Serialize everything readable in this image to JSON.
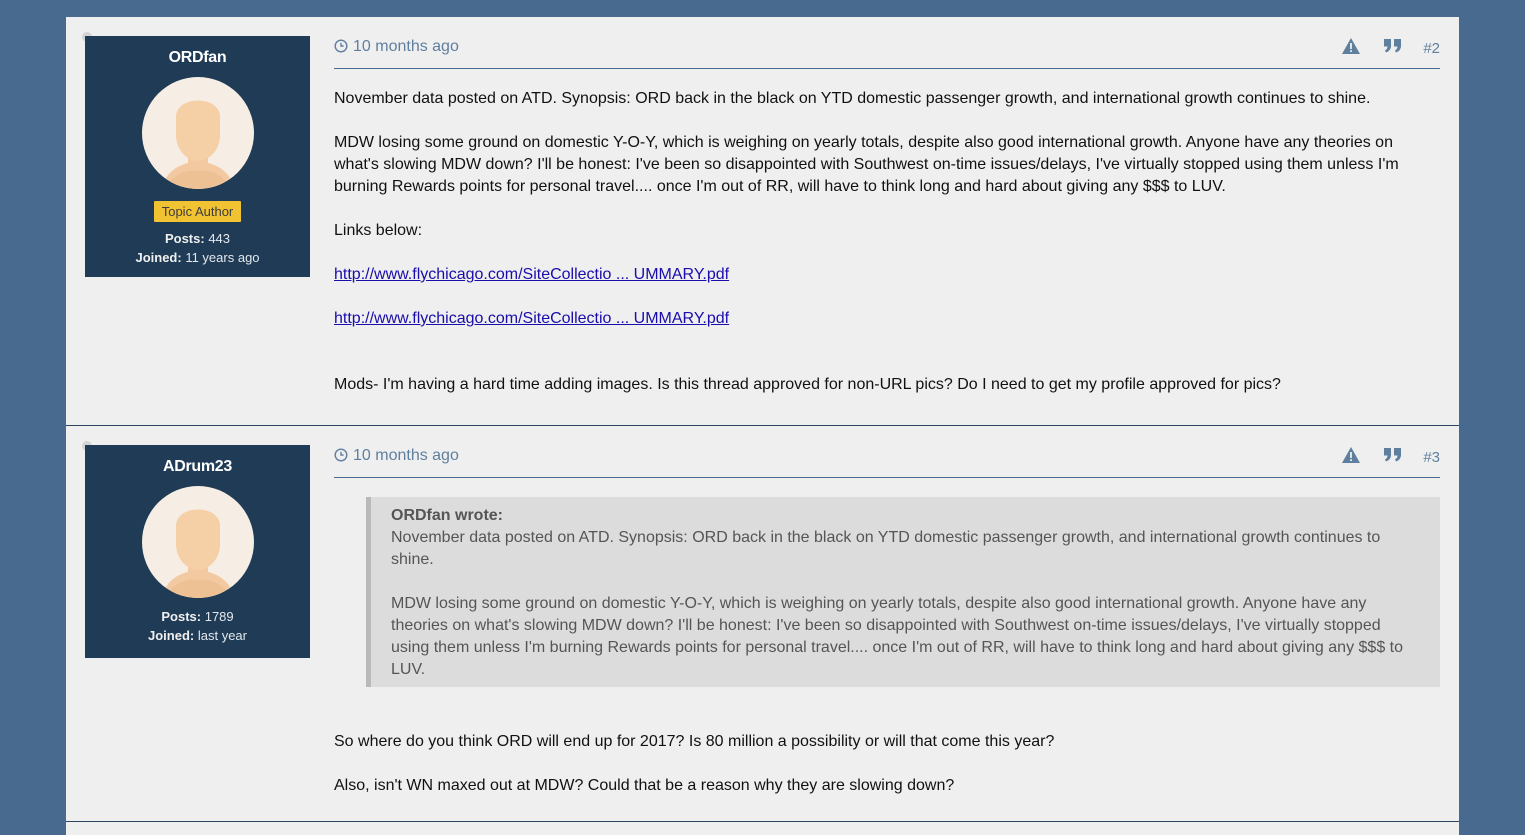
{
  "posts": [
    {
      "author": "ORDfan",
      "badge": "Topic Author",
      "posts_label": "Posts:",
      "posts_count": "443",
      "joined_label": "Joined:",
      "joined_value": "11 years ago",
      "timestamp": "10 months ago",
      "number": "#2",
      "paragraphs": [
        "November data posted on ATD. Synopsis: ORD back in the black on YTD domestic passenger growth, and international growth continues to shine.",
        "MDW losing some ground on domestic Y-O-Y, which is weighing on yearly totals, despite also good international growth. Anyone have any theories on what's slowing MDW down? I'll be honest: I've been so disappointed with Southwest on-time issues/delays, I've virtually stopped using them unless I'm burning Rewards points for personal travel.... once I'm out of RR, will have to think long and hard about giving any $$$ to LUV.",
        "Links below:"
      ],
      "links": [
        "http://www.flychicago.com/SiteCollectio ... UMMARY.pdf",
        "http://www.flychicago.com/SiteCollectio ... UMMARY.pdf"
      ],
      "closing": "Mods- I'm having a hard time adding images. Is this thread approved for non-URL pics? Do I need to get my profile approved for pics?"
    },
    {
      "author": "ADrum23",
      "posts_label": "Posts:",
      "posts_count": "1789",
      "joined_label": "Joined:",
      "joined_value": "last year",
      "timestamp": "10 months ago",
      "number": "#3",
      "quote": {
        "author": "ORDfan wrote:",
        "paragraphs": [
          "November data posted on ATD. Synopsis: ORD back in the black on YTD domestic passenger growth, and international growth continues to shine.",
          "MDW losing some ground on domestic Y-O-Y, which is weighing on yearly totals, despite also good international growth. Anyone have any theories on what's slowing MDW down? I'll be honest: I've been so disappointed with Southwest on-time issues/delays, I've virtually stopped using them unless I'm burning Rewards points for personal travel.... once I'm out of RR, will have to think long and hard about giving any $$$ to LUV."
        ]
      },
      "paragraphs": [
        "So where do you think ORD will end up for 2017? Is 80 million a possibility or will that come this year?",
        "Also, isn't WN maxed out at MDW? Could that be a reason why they are slowing down?"
      ]
    }
  ],
  "icons": {
    "clock": "clock-icon",
    "report": "warning-triangle-icon",
    "quote": "quote-marks-icon",
    "avatar": "default-avatar-icon"
  },
  "colors": {
    "page_background": "#486a8e",
    "profile_background": "#1f3b55",
    "badge": "#f1c232",
    "meta_text": "#5f7f9f",
    "link": "#1a0dab"
  }
}
